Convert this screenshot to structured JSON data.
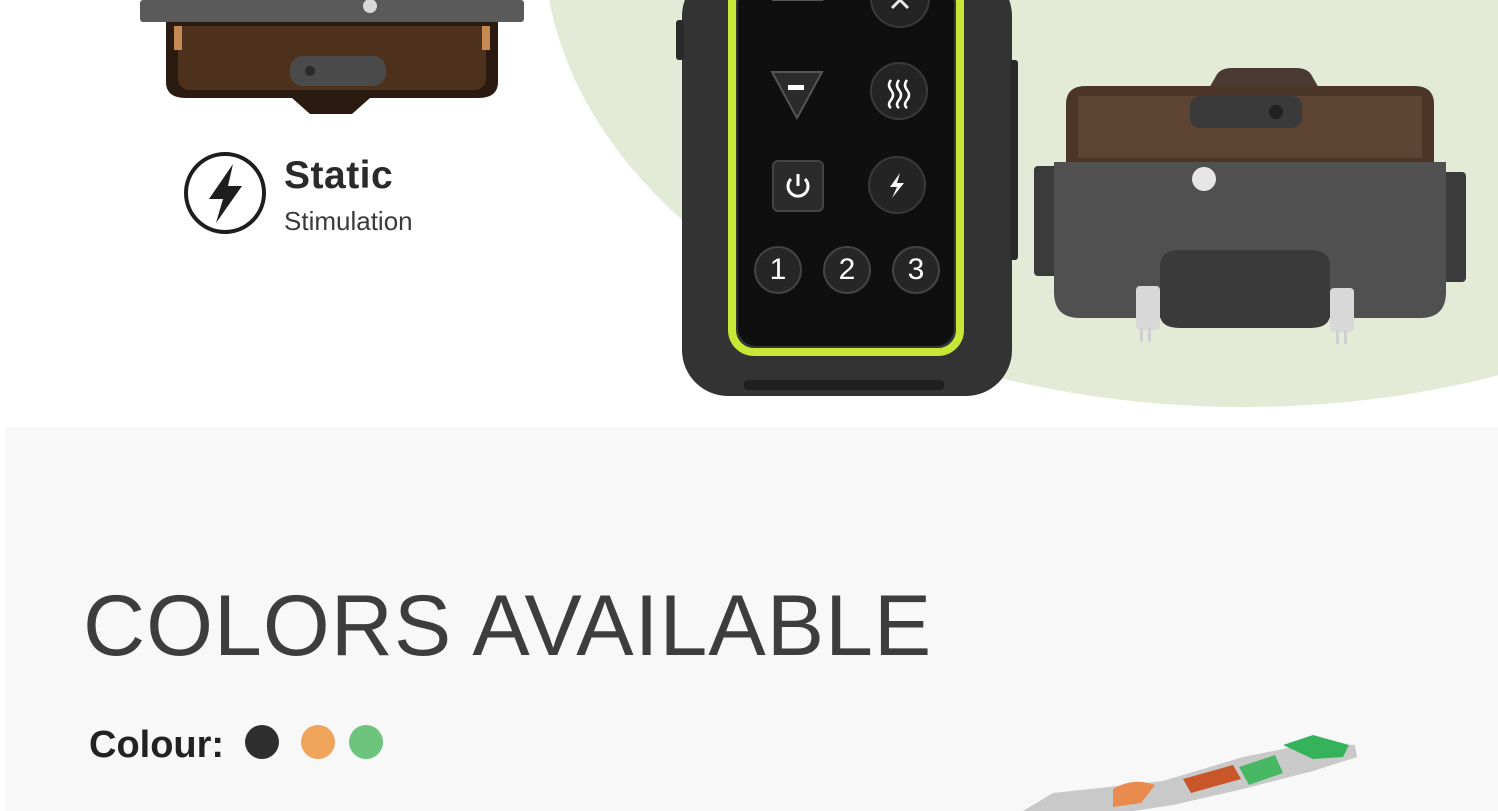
{
  "feature": {
    "title": "Static",
    "subtitle": "Stimulation",
    "icon": "lightning-bolt-icon"
  },
  "remote": {
    "buttons": [
      "1",
      "2",
      "3"
    ],
    "accent_color": "#c8e636"
  },
  "colors_section": {
    "heading": "COLORS AVAILABLE",
    "colour_label": "Colour:",
    "swatches": [
      {
        "name": "black",
        "hex": "#2e2e2e"
      },
      {
        "name": "orange",
        "hex": "#f0a35a"
      },
      {
        "name": "green",
        "hex": "#6cc47d"
      }
    ]
  },
  "theme": {
    "arc_background": "#e3ebd6",
    "section_background": "#f8f8f8"
  }
}
